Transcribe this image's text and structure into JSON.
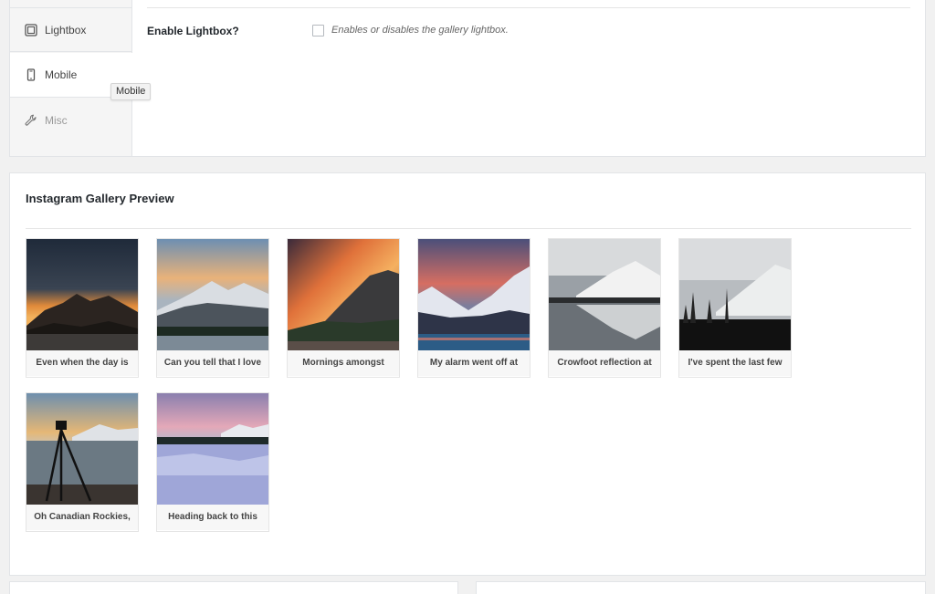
{
  "settings": {
    "tabs": [
      {
        "label": "Lightbox",
        "icon": "lightbox-icon"
      },
      {
        "label": "Mobile",
        "icon": "mobile-icon"
      },
      {
        "label": "Misc",
        "icon": "wrench-icon"
      }
    ],
    "tooltip": "Mobile",
    "field_label": "Enable Lightbox?",
    "field_description": "Enables or disables the gallery lightbox.",
    "checkbox_checked": false
  },
  "gallery": {
    "title": "Instagram Gallery Preview",
    "items": [
      {
        "caption": "Even when the day is"
      },
      {
        "caption": "Can you tell that I love"
      },
      {
        "caption": "Mornings amongst"
      },
      {
        "caption": "My alarm went off at"
      },
      {
        "caption": "Crowfoot reflection at"
      },
      {
        "caption": "I've spent the last few"
      },
      {
        "caption": "Oh Canadian Rockies,"
      },
      {
        "caption": "Heading back to this"
      }
    ]
  }
}
